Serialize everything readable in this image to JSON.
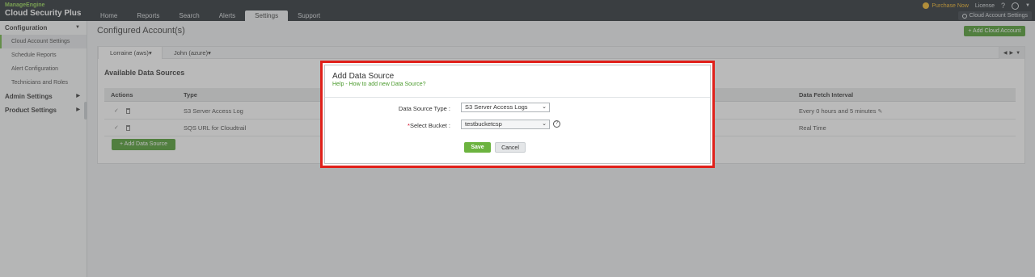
{
  "brand": {
    "vendor": "ManageEngine",
    "product": "Cloud Security Plus"
  },
  "nav": {
    "tabs": [
      "Home",
      "Reports",
      "Search",
      "Alerts",
      "Settings",
      "Support"
    ],
    "active": "Settings"
  },
  "topright": {
    "purchase": "Purchase Now",
    "license": "License",
    "help": "?",
    "cloud_settings": "Cloud Account Settings"
  },
  "sidebar": {
    "configuration": "Configuration",
    "items": [
      "Cloud Account Settings",
      "Schedule Reports",
      "Alert Configuration",
      "Technicians and Roles"
    ],
    "admin_settings": "Admin Settings",
    "product_settings": "Product Settings"
  },
  "main": {
    "title": "Configured Account(s)",
    "add_account": "+ Add Cloud Account",
    "account_tabs": [
      "Lorraine (aws)",
      "John (azure)"
    ],
    "available_title": "Available Data Sources",
    "columns": {
      "actions": "Actions",
      "type": "Type",
      "interval": "Data Fetch Interval"
    },
    "rows": [
      {
        "type": "S3 Server Access Log",
        "interval": "Every 0 hours and 5 minutes"
      },
      {
        "type": "SQS URL for Cloudtrail",
        "interval": "Real Time"
      }
    ],
    "add_data_source": "+ Add Data Source"
  },
  "modal": {
    "title": "Add Data Source",
    "help_link": "Help - How to add new Data Source?",
    "source_type_label": "Data Source Type :",
    "source_type_value": "S3 Server Access Logs",
    "required_mark": "*",
    "bucket_label": "Select Bucket :",
    "bucket_value": "testbucketcsp",
    "save": "Save",
    "cancel": "Cancel"
  },
  "colors": {
    "accent_green": "#4a9a2c",
    "highlight_red": "#e0201a",
    "topbar": "#242a30"
  }
}
